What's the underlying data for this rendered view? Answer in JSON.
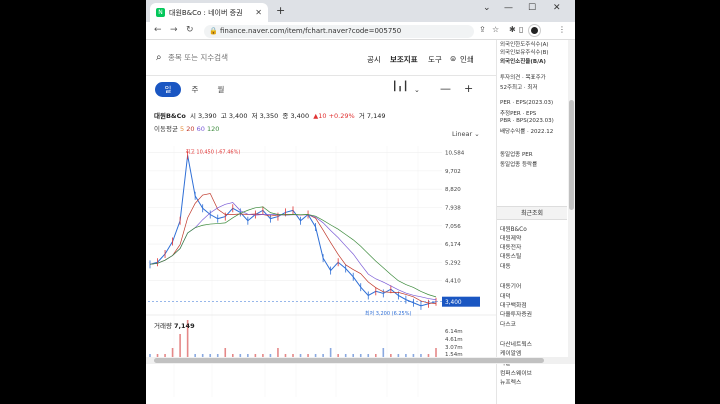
{
  "browser": {
    "tab_title": "대원B&Co : 네이버 증권",
    "url": "finance.naver.com/item/fchart.naver?code=005750",
    "favicon": "N"
  },
  "search": {
    "placeholder": "종목 또는 지수검색"
  },
  "toplinks": {
    "notice": "공시",
    "indicator": "보조지표",
    "tools": "도구",
    "print": "인쇄"
  },
  "periods": [
    "일",
    "주",
    "월"
  ],
  "quote": {
    "name": "대원B&Co",
    "open_label": "시",
    "open": "3,390",
    "high_label": "고",
    "high": "3,400",
    "low_label": "저",
    "low": "3,350",
    "close_label": "종",
    "close": "3,400",
    "change": "▲10",
    "change_pct": "+0.29%",
    "volume_label": "거",
    "volume": "7,149"
  },
  "ma": {
    "label": "이동평균",
    "periods": [
      "5",
      "20",
      "60",
      "120"
    ],
    "colors": [
      "#e58f3c",
      "#c0392b",
      "#7a5bd6",
      "#3d8b3d"
    ]
  },
  "scale_mode": "Linear",
  "chart_data": {
    "type": "line",
    "title": "",
    "y_ticks": [
      "10,584",
      "9,702",
      "8,820",
      "7,938",
      "7,056",
      "6,174",
      "5,292",
      "4,410",
      "3,400"
    ],
    "x_ticks": [
      "4월",
      "8월",
      "2022",
      "4월",
      "8월",
      "2023",
      "4월"
    ],
    "ylim": [
      3000,
      10900
    ],
    "max_label": "최고 10,450 (-67.46%)",
    "min_label": "최저 3,200 (6.25%)",
    "current_price": "3,400",
    "series": [
      {
        "values": [
          5200,
          5300,
          5700,
          6300,
          7300,
          10450,
          8500,
          7900,
          7600,
          7400,
          7500,
          7900,
          7700,
          7300,
          7600,
          7800,
          7400,
          7500,
          7700,
          7800,
          7300,
          7600,
          7000,
          5500,
          4900,
          5300,
          5000,
          4600,
          4100,
          3700,
          3900,
          3800,
          4000,
          3700,
          3500,
          3350,
          3200,
          3300,
          3400
        ]
      }
    ],
    "volume_ticks": [
      "6.14m",
      "4.61m",
      "3.07m",
      "1.54m"
    ]
  },
  "volume_label": "거래량",
  "volume_value": "7,149",
  "side_panel": {
    "lines": [
      "외국인한도주식수(A)",
      "외국인보유주식수(B)",
      "외국인소진율(B/A)",
      "투자의견 · 목표주가",
      "52주최고 · 최저",
      "PER · EPS(2023.03)",
      "추정PER · EPS",
      "PBR · BPS(2023.03)",
      "배당수익률 · 2022.12",
      "동일업종 PER",
      "동일업종 등락률"
    ],
    "recent_header": "최근조회",
    "recent": [
      "대원B&Co",
      "대원제약",
      "대동전자",
      "대동스틸",
      "대동",
      "대동기어",
      "대덕",
      "대구백화점",
      "다올투자증권",
      "다스코",
      "다산네트웍스",
      "케이알엠",
      "다날",
      "컴퍼스웨이브",
      "뉴프렉스"
    ]
  }
}
